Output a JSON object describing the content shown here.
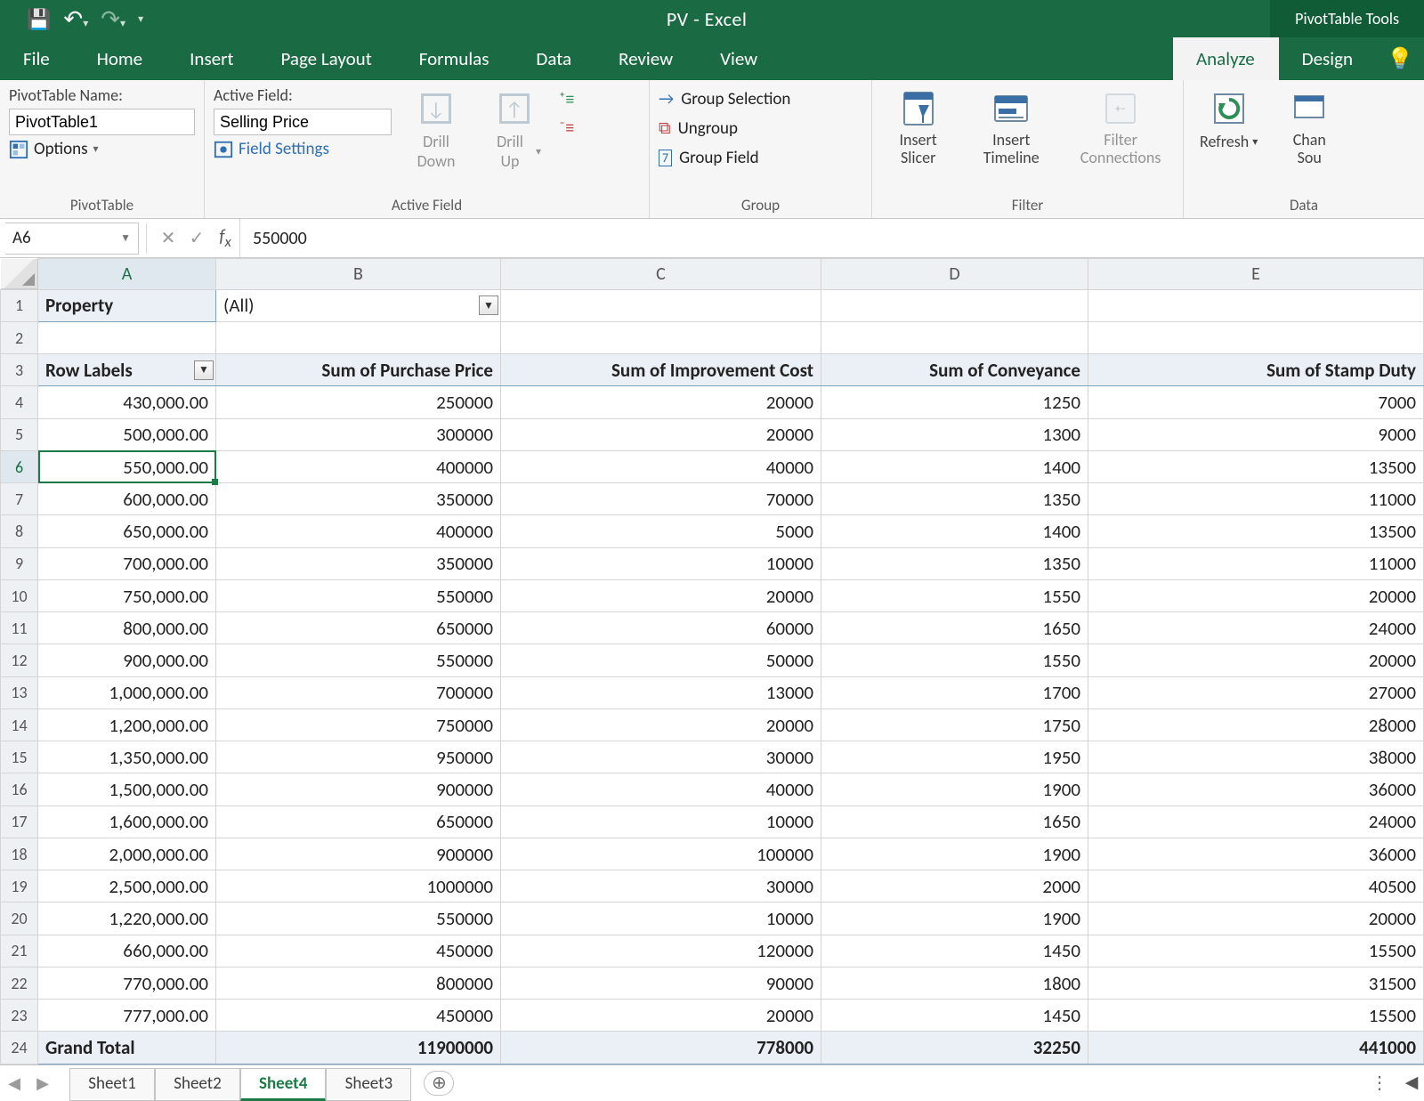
{
  "title": "PV - Excel",
  "tools_title": "PivotTable Tools",
  "tabs": [
    "File",
    "Home",
    "Insert",
    "Page Layout",
    "Formulas",
    "Data",
    "Review",
    "View",
    "Analyze",
    "Design"
  ],
  "ribbon": {
    "pt_name_label": "PivotTable Name:",
    "pt_name": "PivotTable1",
    "options": "Options",
    "group_pt": "PivotTable",
    "active_field_label": "Active Field:",
    "active_field": "Selling Price",
    "field_settings": "Field Settings",
    "drill_down": "Drill Down",
    "drill_up": "Drill Up",
    "group_af": "Active Field",
    "group_selection": "Group Selection",
    "ungroup": "Ungroup",
    "group_field": "Group Field",
    "group_group": "Group",
    "insert_slicer": "Insert Slicer",
    "insert_timeline": "Insert Timeline",
    "filter_connections": "Filter Connections",
    "group_filter": "Filter",
    "refresh": "Refresh",
    "change_src_1": "Chan",
    "change_src_2": "Sou",
    "group_data": "Data"
  },
  "namebox": "A6",
  "formula": "550000",
  "columns": [
    "A",
    "B",
    "C",
    "D",
    "E"
  ],
  "filter": {
    "label": "Property",
    "value": "(All)"
  },
  "headers": [
    "Row Labels",
    "Sum of Purchase Price",
    "Sum of Improvement Cost",
    "Sum of Conveyance",
    "Sum of Stamp Duty"
  ],
  "rows": [
    {
      "n": 4,
      "c": [
        "430,000.00",
        "250000",
        "20000",
        "1250",
        "7000"
      ]
    },
    {
      "n": 5,
      "c": [
        "500,000.00",
        "300000",
        "20000",
        "1300",
        "9000"
      ]
    },
    {
      "n": 6,
      "c": [
        "550,000.00",
        "400000",
        "40000",
        "1400",
        "13500"
      ],
      "sel": true
    },
    {
      "n": 7,
      "c": [
        "600,000.00",
        "350000",
        "70000",
        "1350",
        "11000"
      ]
    },
    {
      "n": 8,
      "c": [
        "650,000.00",
        "400000",
        "5000",
        "1400",
        "13500"
      ]
    },
    {
      "n": 9,
      "c": [
        "700,000.00",
        "350000",
        "10000",
        "1350",
        "11000"
      ]
    },
    {
      "n": 10,
      "c": [
        "750,000.00",
        "550000",
        "20000",
        "1550",
        "20000"
      ]
    },
    {
      "n": 11,
      "c": [
        "800,000.00",
        "650000",
        "60000",
        "1650",
        "24000"
      ]
    },
    {
      "n": 12,
      "c": [
        "900,000.00",
        "550000",
        "50000",
        "1550",
        "20000"
      ]
    },
    {
      "n": 13,
      "c": [
        "1,000,000.00",
        "700000",
        "13000",
        "1700",
        "27000"
      ]
    },
    {
      "n": 14,
      "c": [
        "1,200,000.00",
        "750000",
        "20000",
        "1750",
        "28000"
      ]
    },
    {
      "n": 15,
      "c": [
        "1,350,000.00",
        "950000",
        "30000",
        "1950",
        "38000"
      ]
    },
    {
      "n": 16,
      "c": [
        "1,500,000.00",
        "900000",
        "40000",
        "1900",
        "36000"
      ]
    },
    {
      "n": 17,
      "c": [
        "1,600,000.00",
        "650000",
        "10000",
        "1650",
        "24000"
      ]
    },
    {
      "n": 18,
      "c": [
        "2,000,000.00",
        "900000",
        "100000",
        "1900",
        "36000"
      ]
    },
    {
      "n": 19,
      "c": [
        "2,500,000.00",
        "1000000",
        "30000",
        "2000",
        "40500"
      ]
    },
    {
      "n": 20,
      "c": [
        "1,220,000.00",
        "550000",
        "10000",
        "1900",
        "20000"
      ]
    },
    {
      "n": 21,
      "c": [
        "660,000.00",
        "450000",
        "120000",
        "1450",
        "15500"
      ]
    },
    {
      "n": 22,
      "c": [
        "770,000.00",
        "800000",
        "90000",
        "1800",
        "31500"
      ]
    },
    {
      "n": 23,
      "c": [
        "777,000.00",
        "450000",
        "20000",
        "1450",
        "15500"
      ]
    }
  ],
  "grand": {
    "n": 24,
    "label": "Grand Total",
    "c": [
      "11900000",
      "778000",
      "32250",
      "441000"
    ]
  },
  "sheets": [
    "Sheet1",
    "Sheet2",
    "Sheet4",
    "Sheet3"
  ],
  "active_sheet": "Sheet4",
  "chart_data": {
    "type": "table",
    "title": "PivotTable — Row Labels by Selling Price",
    "columns": [
      "Selling Price",
      "Sum of Purchase Price",
      "Sum of Improvement Cost",
      "Sum of Conveyance",
      "Sum of Stamp Duty"
    ],
    "rows": [
      [
        430000,
        250000,
        20000,
        1250,
        7000
      ],
      [
        500000,
        300000,
        20000,
        1300,
        9000
      ],
      [
        550000,
        400000,
        40000,
        1400,
        13500
      ],
      [
        600000,
        350000,
        70000,
        1350,
        11000
      ],
      [
        650000,
        400000,
        5000,
        1400,
        13500
      ],
      [
        700000,
        350000,
        10000,
        1350,
        11000
      ],
      [
        750000,
        550000,
        20000,
        1550,
        20000
      ],
      [
        800000,
        650000,
        60000,
        1650,
        24000
      ],
      [
        900000,
        550000,
        50000,
        1550,
        20000
      ],
      [
        1000000,
        700000,
        13000,
        1700,
        27000
      ],
      [
        1200000,
        750000,
        20000,
        1750,
        28000
      ],
      [
        1350000,
        950000,
        30000,
        1950,
        38000
      ],
      [
        1500000,
        900000,
        40000,
        1900,
        36000
      ],
      [
        1600000,
        650000,
        10000,
        1650,
        24000
      ],
      [
        2000000,
        900000,
        100000,
        1900,
        36000
      ],
      [
        2500000,
        1000000,
        30000,
        2000,
        40500
      ],
      [
        1220000,
        550000,
        10000,
        1900,
        20000
      ],
      [
        660000,
        450000,
        120000,
        1450,
        15500
      ],
      [
        770000,
        800000,
        90000,
        1800,
        31500
      ],
      [
        777000,
        450000,
        20000,
        1450,
        15500
      ]
    ],
    "totals": [
      11900000,
      778000,
      32250,
      441000
    ]
  }
}
